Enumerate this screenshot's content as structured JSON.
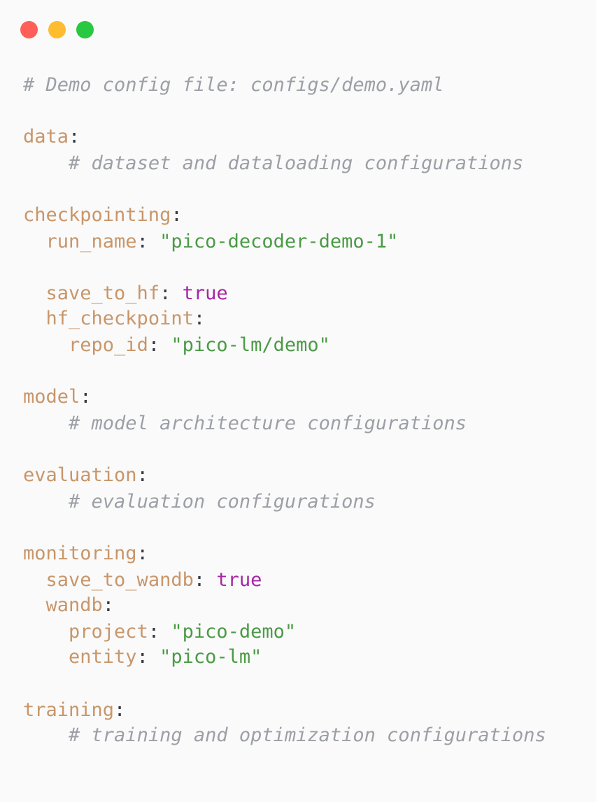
{
  "window": {
    "buttons": [
      "close",
      "minimize",
      "maximize"
    ],
    "colors": {
      "close": "#ff5f57",
      "minimize": "#febc2e",
      "maximize": "#28c840",
      "background": "#fafafa"
    }
  },
  "syntax_colors": {
    "key": "#c8966a",
    "string": "#4b9a46",
    "boolean": "#a626a4",
    "comment": "#9d9fa6",
    "punctuation": "#383a42"
  },
  "code": {
    "header_comment": "# Demo config file: configs/demo.yaml",
    "data": {
      "key": "data",
      "comment": "# dataset and dataloading configurations"
    },
    "checkpointing": {
      "key": "checkpointing",
      "run_name_key": "run_name",
      "run_name_value": "\"pico-decoder-demo-1\"",
      "save_to_hf_key": "save_to_hf",
      "save_to_hf_value": "true",
      "hf_checkpoint_key": "hf_checkpoint",
      "repo_id_key": "repo_id",
      "repo_id_value": "\"pico-lm/demo\""
    },
    "model": {
      "key": "model",
      "comment": "# model architecture configurations"
    },
    "evaluation": {
      "key": "evaluation",
      "comment": "# evaluation configurations"
    },
    "monitoring": {
      "key": "monitoring",
      "save_to_wandb_key": "save_to_wandb",
      "save_to_wandb_value": "true",
      "wandb_key": "wandb",
      "project_key": "project",
      "project_value": "\"pico-demo\"",
      "entity_key": "entity",
      "entity_value": "\"pico-lm\""
    },
    "training": {
      "key": "training",
      "comment": "# training and optimization configurations"
    },
    "colon": ":",
    "colon_space": ": "
  }
}
